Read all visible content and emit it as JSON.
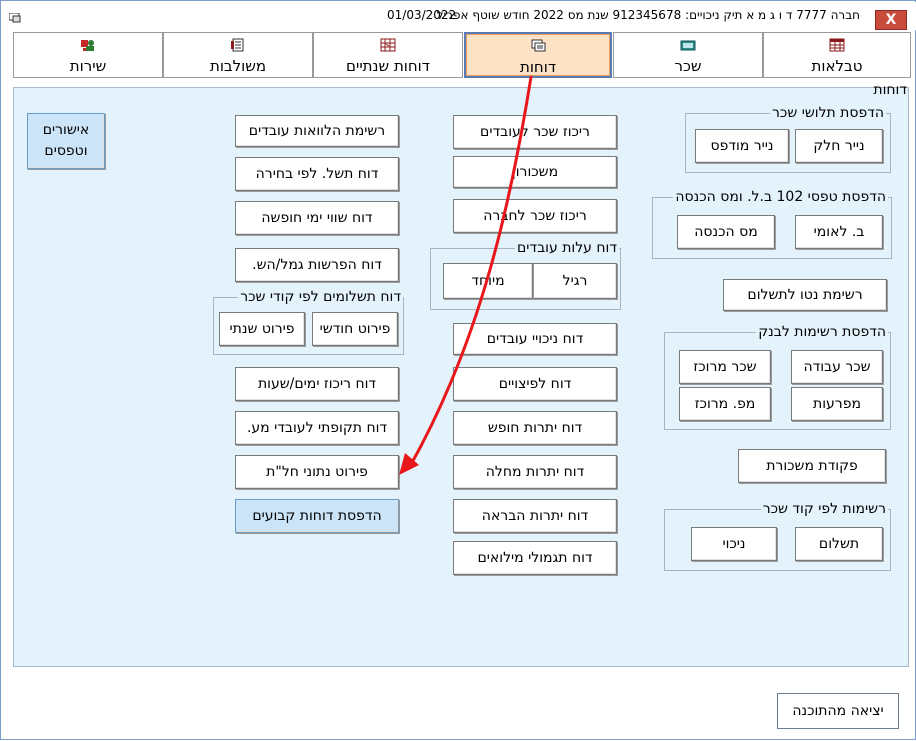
{
  "titlebar": {
    "title": "חברה 7777 ד ו ג מ א  תיק ניכויים: 912345678   שנת מס 2022   חודש שוטף אפריל",
    "date": "01/03/2022",
    "close_label": "X"
  },
  "tabs": [
    {
      "label": "טבלאות",
      "icon": "table-icon"
    },
    {
      "label": "שכר",
      "icon": "salary-icon"
    },
    {
      "label": "דוחות",
      "icon": "reports-icon",
      "active": true
    },
    {
      "label": "דוחות שנתיים",
      "icon": "annual-reports-icon"
    },
    {
      "label": "משולבות",
      "icon": "combined-icon"
    },
    {
      "label": "שירות",
      "icon": "service-icon"
    }
  ],
  "section_title": "דוחות",
  "groups": {
    "payslips": {
      "title": "הדפסת תלושי שכר",
      "btn_plain": "נייר חלק",
      "btn_printed": "נייר מודפס"
    },
    "forms102": {
      "title": "הדפסת טפסי 102 ב.ל. ומס הכנסה",
      "btn_nii": "ב. לאומי",
      "btn_tax": "מס הכנסה"
    },
    "bank": {
      "title": "הדפסת רשימות לבנק",
      "btn_work_salary": "שכר עבודה",
      "btn_central_salary": "שכר מרוכז",
      "btn_advances": "מפרעות",
      "btn_central_num": "מפ. מרוכז"
    },
    "by_code": {
      "title": "רשימות לפי קוד שכר",
      "btn_payment": "תשלום",
      "btn_deduction": "ניכוי"
    },
    "employee_cost": {
      "title": "דוח עלות עובדים",
      "btn_regular": "רגיל",
      "btn_special": "מיוחד"
    },
    "payments_by_code": {
      "title": "דוח תשלומים לפי קודי שכר",
      "btn_monthly": "פירוט חודשי",
      "btn_annual": "פירוט שנתי"
    }
  },
  "buttons": {
    "net_list": "רשימת נטו לתשלום",
    "payroll_order": "פקודת משכורת",
    "salary_summary": "ריכוז שכר לעובדים",
    "payroll": "משכורון",
    "company_summary": "ריכוז שכר לחברה",
    "deductions_report": "דוח ניכויי עובדים",
    "severance_report": "דוח לפיצויים",
    "vacation_balance": "דוח יתרות חופש",
    "sick_balance": "דוח יתרות מחלה",
    "recovery_balance": "דוח יתרות הבראה",
    "reserve_report": "דוח תגמולי מילואים",
    "loans_list": "רשימת הלוואות עובדים",
    "payment_by_choice": "דוח תשל. לפי בחירה",
    "vacation_value": "דוח שווי ימי חופשה",
    "pension_deposits": "דוח הפרשות גמל/הש.",
    "days_hours": "דוח ריכוז ימים/שעות",
    "periodic_report": "דוח תקופתי לעובדי מע.",
    "abroad_details": "פירוט נתוני חל\"ת",
    "fixed_reports": "הדפסת דוחות קבועים",
    "approvals": "אישורים וטפסים"
  },
  "exit_label": "יציאה מהתוכנה",
  "colors": {
    "panel_bg": "#e3f2fb",
    "active_tab": "#fde2c6",
    "arrow": "#e8171b",
    "blue_button": "#cce4f7"
  }
}
